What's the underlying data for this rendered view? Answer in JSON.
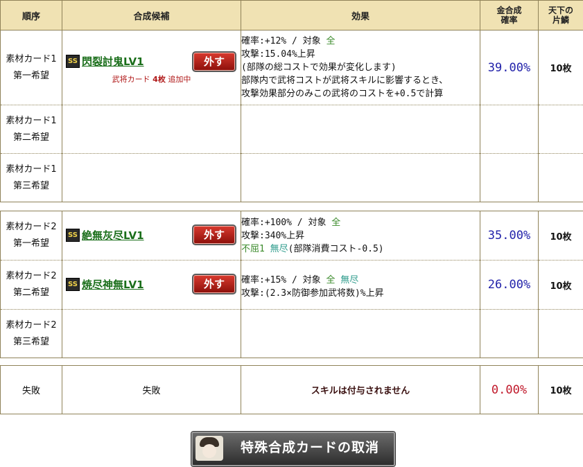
{
  "headers": {
    "order": "順序",
    "candidate": "合成候補",
    "effect": "効果",
    "gold_rate_l1": "金合成",
    "gold_rate_l2": "確率",
    "frag_l1": "天下の",
    "frag_l2": "片鱗"
  },
  "group1": [
    {
      "order_l1": "素材カード1",
      "order_l2": "第一希望",
      "rank": "SS",
      "name": "閃裂討鬼LV1",
      "remove": "外す",
      "note_pre": "武将カード",
      "note_count": "4枚",
      "note_post": "追加中",
      "effect_l1a": "確率:+12% / 対象 ",
      "effect_l1b": "全",
      "effect_l2": "攻撃:15.04%上昇",
      "effect_l3": "(部隊の総コストで効果が変化します)",
      "effect_l4": "部隊内で武将コストが武将スキルに影響するとき、",
      "effect_l5": "攻撃効果部分のみこの武将のコストを+0.5で計算",
      "rate": "39.00%",
      "frag": "10枚"
    },
    {
      "order_l1": "素材カード1",
      "order_l2": "第二希望"
    },
    {
      "order_l1": "素材カード1",
      "order_l2": "第三希望"
    }
  ],
  "group2": [
    {
      "order_l1": "素材カード2",
      "order_l2": "第一希望",
      "rank": "SS",
      "name": "絶無灰尽LV1",
      "remove": "外す",
      "effect_l1a": "確率:+100% / 対象 ",
      "effect_l1b": "全",
      "effect_l2": "攻撃:340%上昇",
      "effect_l3a": "不屈1",
      "effect_l3b": "無尽",
      "effect_l3c": "(部隊消費コスト-0.5)",
      "rate": "35.00%",
      "frag": "10枚"
    },
    {
      "order_l1": "素材カード2",
      "order_l2": "第二希望",
      "rank": "SS",
      "name": "焼尽神無LV1",
      "remove": "外す",
      "effect_l1a": "確率:+15% / 対象 ",
      "effect_l1b": "全",
      "effect_l1c": "無尽",
      "effect_l2": "攻撃:(2.3×防御参加武将数)%上昇",
      "rate": "26.00%",
      "frag": "10枚"
    },
    {
      "order_l1": "素材カード2",
      "order_l2": "第三希望"
    }
  ],
  "failure": {
    "order": "失敗",
    "candidate": "失敗",
    "effect": "スキルは付与されません",
    "rate": "0.00%",
    "frag": "10枚"
  },
  "cancel_button": "特殊合成カードの取消"
}
